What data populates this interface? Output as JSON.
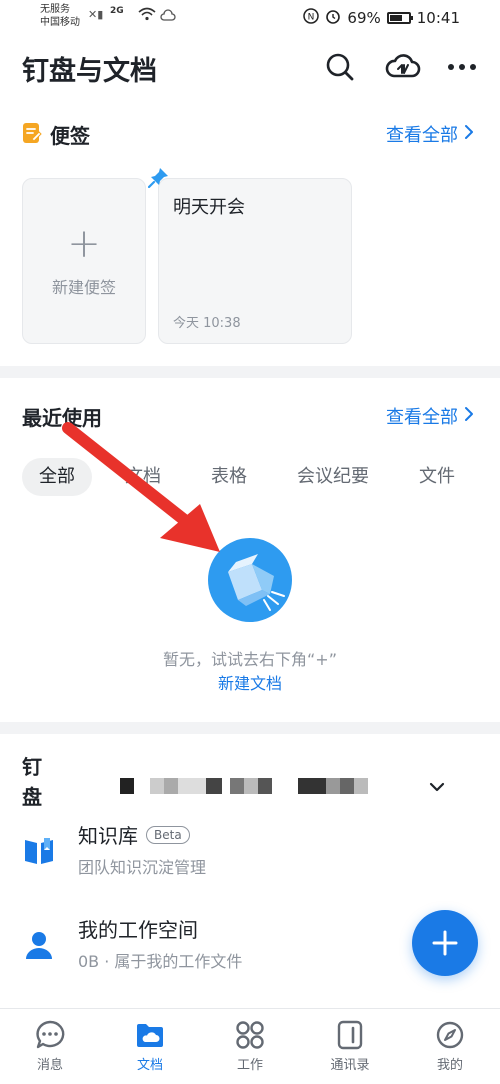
{
  "status_bar": {
    "carrier_line1": "无服务",
    "carrier_line2": "中国移动",
    "network": "2G",
    "battery_percent": "69%",
    "battery_level": 0.69,
    "time": "10:41"
  },
  "header": {
    "title": "钉盘与文档"
  },
  "notes": {
    "title": "便签",
    "view_all": "查看全部",
    "new_note_label": "新建便签",
    "items": [
      {
        "title": "明天开会",
        "time": "今天 10:38"
      }
    ]
  },
  "recent": {
    "title": "最近使用",
    "view_all": "查看全部",
    "tabs": [
      "全部",
      "文档",
      "表格",
      "会议纪要",
      "文件"
    ],
    "active_tab": "全部",
    "empty_text": "暂无，试试去右下角“+”",
    "empty_link": "新建文档"
  },
  "drive": {
    "title": "钉盘",
    "items": [
      {
        "title": "知识库",
        "badge": "Beta",
        "subtitle": "团队知识沉淀管理"
      },
      {
        "title": "我的工作空间",
        "subtitle": "0B · 属于我的工作文件"
      }
    ]
  },
  "bottom_nav": {
    "items": [
      {
        "label": "消息"
      },
      {
        "label": "文档"
      },
      {
        "label": "工作"
      },
      {
        "label": "通讯录"
      },
      {
        "label": "我的"
      }
    ],
    "active": "文档"
  },
  "colors": {
    "accent": "#1a7ae6",
    "note_icon": "#f5a623",
    "arrow": "#e8322b"
  }
}
